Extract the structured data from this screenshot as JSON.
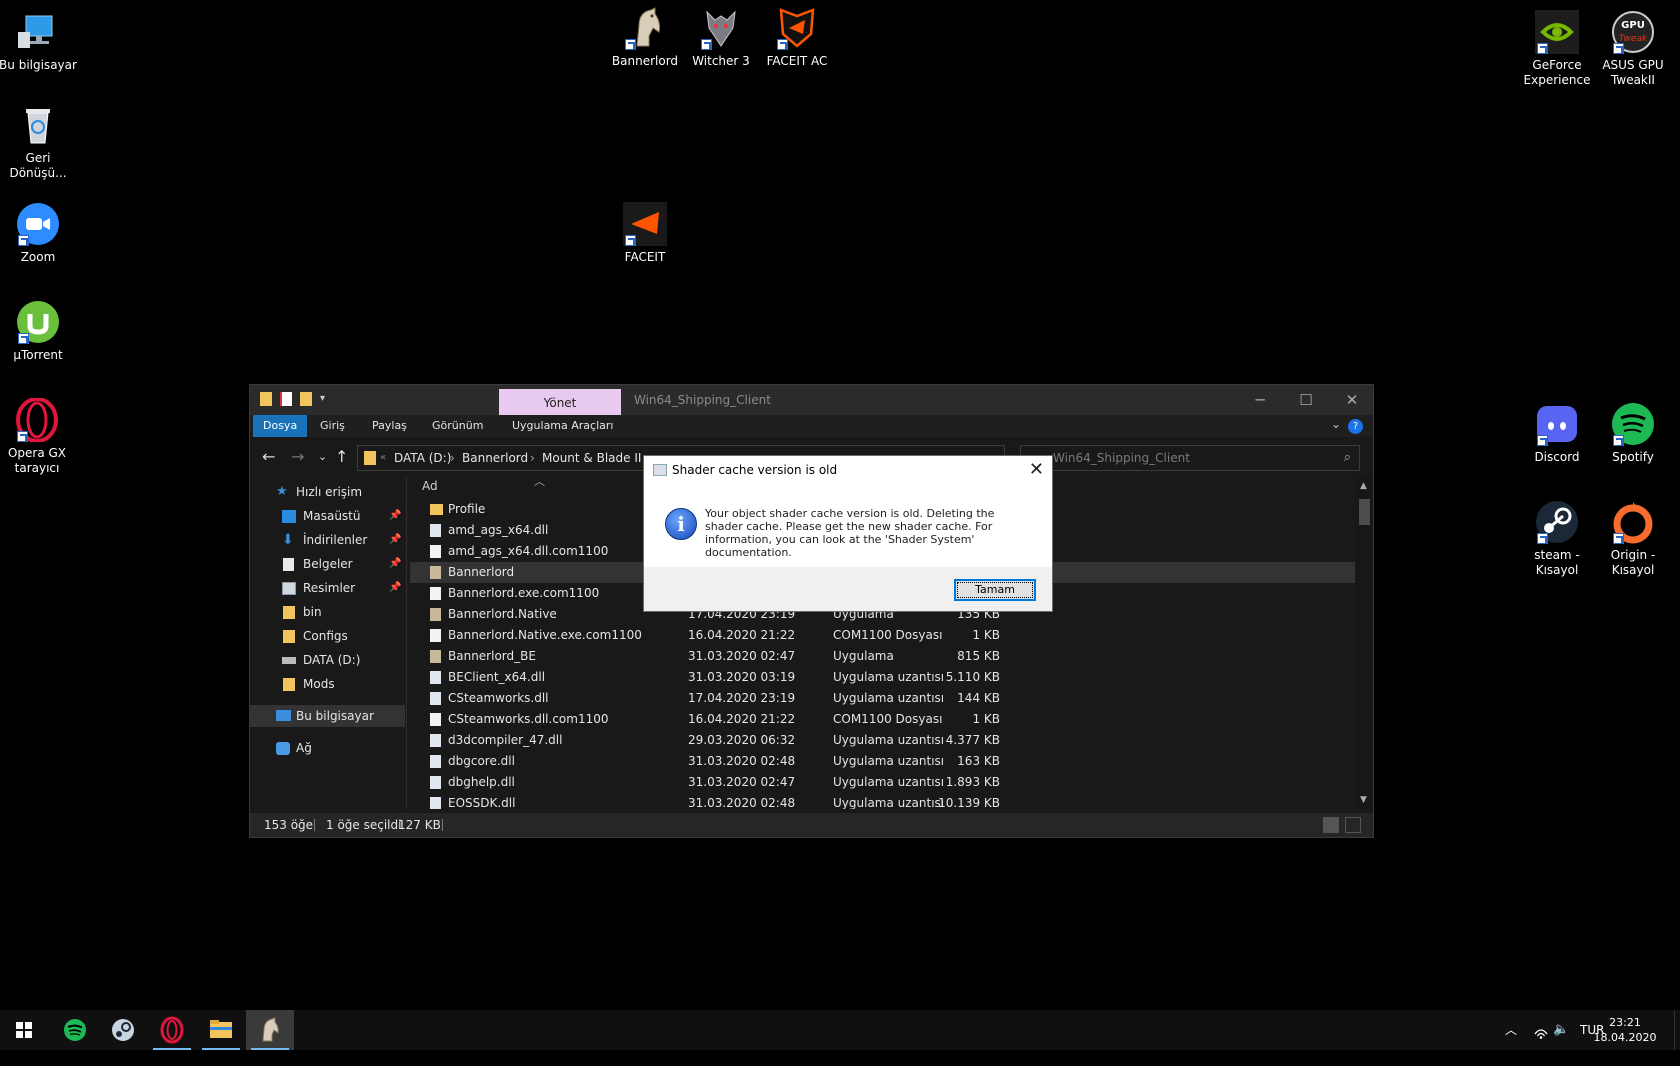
{
  "desktop": {
    "icons": {
      "this_pc": "Bu bilgisayar",
      "recycle": "Geri Dönüşü...",
      "zoom": "Zoom",
      "utorrent": "µTorrent",
      "opera": "Opera GX tarayıcı",
      "bannerlord": "Bannerlord",
      "witcher": "Witcher 3",
      "faceit_ac": "FACEIT AC",
      "faceit": "FACEIT",
      "geforce": "GeForce Experience",
      "asus": "ASUS GPU TweakII",
      "discord": "Discord",
      "spotify": "Spotify",
      "steam": "steam - Kısayol",
      "origin": "Origin - Kısayol"
    }
  },
  "explorer": {
    "manage_tab": "Yönet",
    "title": "Win64_Shipping_Client",
    "ribbon_tabs": [
      "Dosya",
      "Giriş",
      "Paylaş",
      "Görünüm",
      "Uygulama Araçları"
    ],
    "breadcrumb": [
      "DATA (D:)",
      "Bannerlord",
      "Mount & Blade II"
    ],
    "search_placeholder": "Win64_Shipping_Client",
    "nav_items": {
      "quick_access": "Hızlı erişim",
      "desktop": "Masaüstü",
      "downloads": "İndirilenler",
      "documents": "Belgeler",
      "pictures": "Resimler",
      "bin": "bin",
      "configs": "Configs",
      "data_drive": "DATA (D:)",
      "mods": "Mods",
      "this_pc": "Bu bilgisayar",
      "network": "Ağ"
    },
    "column_name": "Ad",
    "files": [
      {
        "name": "Profile",
        "date": "",
        "type": "",
        "size": ""
      },
      {
        "name": "amd_ags_x64.dll",
        "date": "",
        "type": "",
        "size": ""
      },
      {
        "name": "amd_ags_x64.dll.com1100",
        "date": "",
        "type": "",
        "size": ""
      },
      {
        "name": "Bannerlord",
        "date": "",
        "type": "",
        "size": ""
      },
      {
        "name": "Bannerlord.exe.com1100",
        "date": "",
        "type": "",
        "size": ""
      },
      {
        "name": "Bannerlord.Native",
        "date": "17.04.2020 23:19",
        "type": "Uygulama",
        "size": "135 KB"
      },
      {
        "name": "Bannerlord.Native.exe.com1100",
        "date": "16.04.2020 21:22",
        "type": "COM1100 Dosyası",
        "size": "1 KB"
      },
      {
        "name": "Bannerlord_BE",
        "date": "31.03.2020 02:47",
        "type": "Uygulama",
        "size": "815 KB"
      },
      {
        "name": "BEClient_x64.dll",
        "date": "31.03.2020 03:19",
        "type": "Uygulama uzantısı",
        "size": "5.110 KB"
      },
      {
        "name": "CSteamworks.dll",
        "date": "17.04.2020 23:19",
        "type": "Uygulama uzantısı",
        "size": "144 KB"
      },
      {
        "name": "CSteamworks.dll.com1100",
        "date": "16.04.2020 21:22",
        "type": "COM1100 Dosyası",
        "size": "1 KB"
      },
      {
        "name": "d3dcompiler_47.dll",
        "date": "29.03.2020 06:32",
        "type": "Uygulama uzantısı",
        "size": "4.377 KB"
      },
      {
        "name": "dbgcore.dll",
        "date": "31.03.2020 02:48",
        "type": "Uygulama uzantısı",
        "size": "163 KB"
      },
      {
        "name": "dbghelp.dll",
        "date": "31.03.2020 02:47",
        "type": "Uygulama uzantısı",
        "size": "1.893 KB"
      },
      {
        "name": "EOSSDK.dll",
        "date": "31.03.2020 02:48",
        "type": "Uygulama uzantısı",
        "size": "10.139 KB"
      }
    ],
    "status": {
      "count": "153 öğe",
      "selected": "1 öğe seçildi",
      "size": "127 KB"
    }
  },
  "dialog": {
    "title": "Shader cache version is old",
    "message": "Your object shader cache version is old. Deleting the shader cache. Please get the new shader cache. For information, you can look at the 'Shader System' documentation.",
    "ok_label": "Tamam"
  },
  "taskbar": {
    "language": "TUR",
    "time": "23:21",
    "date": "18.04.2020"
  },
  "colors": {
    "accent": "#1a73b8",
    "manage_tab": "#e8c9ef",
    "folder": "#f2c55c"
  }
}
